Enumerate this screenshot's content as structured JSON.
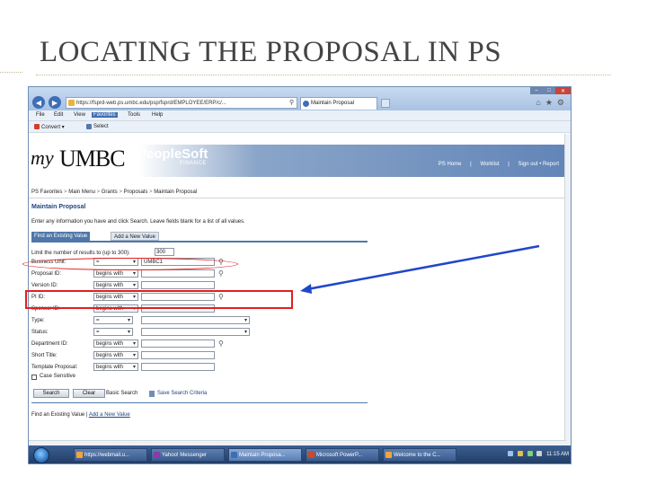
{
  "slide": {
    "title": "LOCATING THE PROPOSAL IN PS"
  },
  "browser": {
    "url": "https://fsprd-web.ps.umbc.edu/psp/fsprd/EMPLOYEE/ERP/c/...",
    "tab_title": "Maintain Proposal",
    "menu": [
      "File",
      "Edit",
      "View",
      "Favorites",
      "Tools",
      "Help"
    ],
    "commands": {
      "convert": "Convert",
      "select": "Select"
    }
  },
  "ps": {
    "logo_my": "my",
    "logo_umbc": "UMBC",
    "product": "PeopleSoft",
    "product_sub": "FINANCE",
    "header_links": [
      "PS Home",
      "Worklist",
      "Sign out • Report"
    ],
    "breadcrumb": [
      "PS Favorites",
      "Main Menu",
      "Grants",
      "Proposals",
      "Maintain Proposal"
    ],
    "breadcrumb_sep": ">",
    "page_title": "Maintain Proposal",
    "instruction": "Enter any information you have and click Search. Leave fields blank for a list of all values.",
    "tabs": {
      "find": "Find an Existing Value",
      "add": "Add a New Value"
    },
    "limit": {
      "label": "Limit the number of results to (up to 300):",
      "value": "300"
    },
    "fields": {
      "business_unit": {
        "label": "Business Unit:",
        "operator": "=",
        "value": "UMBC1"
      },
      "proposal_id": {
        "label": "Proposal ID:",
        "operator": "begins with",
        "value": ""
      },
      "version_id": {
        "label": "Version ID:",
        "operator": "begins with",
        "value": ""
      },
      "pi_id": {
        "label": "PI ID:",
        "operator": "begins with",
        "value": ""
      },
      "sponsor_id": {
        "label": "Sponsor ID:",
        "operator": "begins with",
        "value": ""
      },
      "type": {
        "label": "Type:",
        "operator": "=",
        "value": ""
      },
      "status": {
        "label": "Status:",
        "operator": "=",
        "value": ""
      },
      "department_id": {
        "label": "Department ID:",
        "operator": "begins with",
        "value": ""
      },
      "short_title": {
        "label": "Short Title:",
        "operator": "begins with",
        "value": ""
      },
      "template_proposal": {
        "label": "Template Proposal:",
        "operator": "begins with",
        "value": ""
      }
    },
    "case_sensitive": "Case Sensitive",
    "buttons": {
      "search": "Search",
      "clear": "Clear"
    },
    "basic_search": "Basic Search",
    "save_search": "Save Search Criteria",
    "footer": {
      "find": "Find an Existing Value",
      "sep": "|",
      "add": "Add a New Value"
    }
  },
  "taskbar": {
    "tasks": [
      "https://webmail.u...",
      "Yahoo! Messenger",
      "Maintain Proposa...",
      "Microsoft PowerP...",
      "Welcome to the C..."
    ],
    "time": "11:15 AM"
  },
  "annotation": {
    "highlight_color": "#e02020",
    "arrow_color": "#1f47c9"
  }
}
